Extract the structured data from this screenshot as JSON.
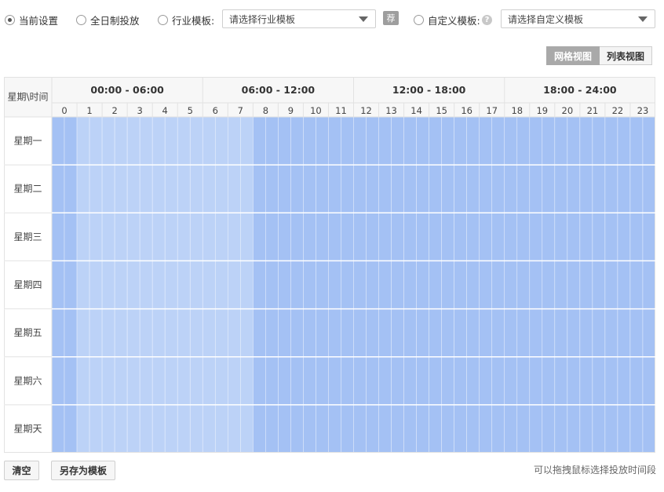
{
  "options": {
    "current": "当前设置",
    "allday": "全日制投放",
    "industry": "行业模板:",
    "industry_placeholder": "请选择行业模板",
    "recommend": "荐",
    "custom": "自定义模板:",
    "custom_placeholder": "请选择自定义模板",
    "help": "?"
  },
  "view": {
    "grid": "网格视图",
    "list": "列表视图"
  },
  "grid": {
    "corner": "星期\\时间",
    "blocks": [
      "00:00 - 06:00",
      "06:00 - 12:00",
      "12:00 - 18:00",
      "18:00 - 24:00"
    ],
    "hours": [
      "0",
      "1",
      "2",
      "3",
      "4",
      "5",
      "6",
      "7",
      "8",
      "9",
      "10",
      "11",
      "12",
      "13",
      "14",
      "15",
      "16",
      "17",
      "18",
      "19",
      "20",
      "21",
      "22",
      "23"
    ],
    "days": [
      "星期一",
      "星期二",
      "星期三",
      "星期四",
      "星期五",
      "星期六",
      "星期天"
    ],
    "selected_light_hours": [
      1,
      2,
      3,
      4,
      5,
      6,
      7
    ],
    "colors": {
      "selected": "#a4c1f4",
      "light": "#bcd2f7",
      "header_bg": "#f7f7f7",
      "border": "#e2e2e2"
    }
  },
  "footer": {
    "clear": "清空",
    "save_template": "另存为模板",
    "hint": "可以拖拽鼠标选择投放时间段"
  }
}
